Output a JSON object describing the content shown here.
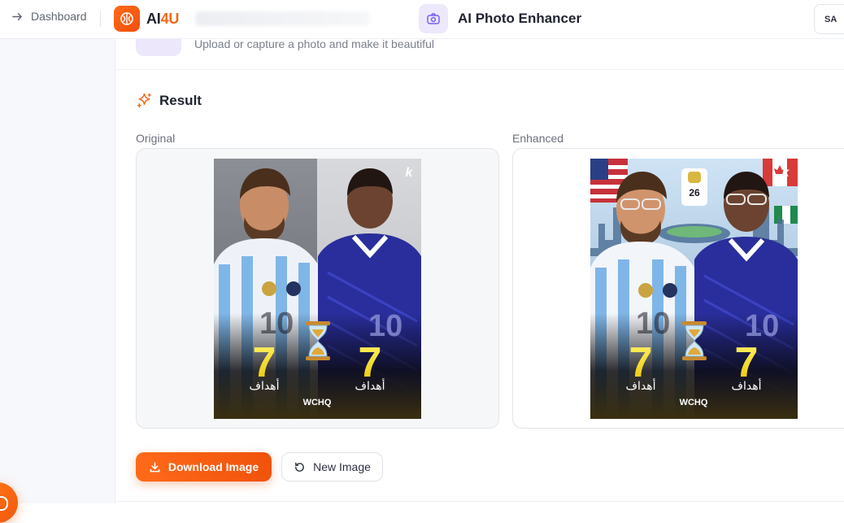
{
  "topbar": {
    "back_label": "Dashboard",
    "brand_main": "AI",
    "brand_accent": "4U",
    "tool_title": "AI Photo Enhancer",
    "language": "SA"
  },
  "subheader": {
    "description": "Upload or capture a photo and make it beautiful"
  },
  "result": {
    "title": "Result",
    "original_label": "Original",
    "enhanced_label": "Enhanced"
  },
  "poster": {
    "left_number": "7",
    "right_number": "7",
    "left_caption": "أهداف",
    "right_caption": "أهداف",
    "left_jersey": "10",
    "right_jersey": "10",
    "watermark": "WCHQ",
    "corner_mark": "k",
    "trophy_year": "26"
  },
  "actions": {
    "download_label": "Download Image",
    "new_label": "New Image"
  },
  "colors": {
    "accent": "#f26a1a",
    "purple_soft": "#ede8fb",
    "purple_icon": "#7c5cff"
  },
  "icons": {
    "back": "arrow-right-icon",
    "logo": "brain-icon",
    "tool": "camera-icon",
    "result": "sparkles-icon",
    "download": "download-icon",
    "new": "refresh-icon"
  }
}
